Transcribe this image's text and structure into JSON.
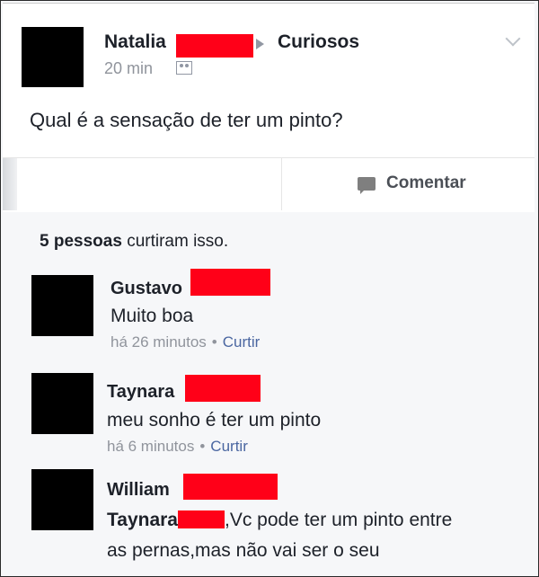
{
  "post": {
    "author": "Natalia",
    "group": "Curiosos",
    "time": "20 min",
    "text": "Qual é a sensação de ter um pinto?"
  },
  "actions": {
    "comment_label": "Comentar"
  },
  "likes": {
    "count": "5 pessoas",
    "suffix": "curtiram isso."
  },
  "comments": [
    {
      "author": "Gustavo",
      "text": "Muito boa",
      "time": "há 26 minutos",
      "like": "Curtir"
    },
    {
      "author": "Taynara",
      "text": "meu sonho é ter um pinto",
      "time": "há 6 minutos",
      "like": "Curtir"
    },
    {
      "author": "William",
      "mention": "Taynara",
      "text": ",Vc pode ter um pinto entre",
      "text2": "as pernas,mas não vai ser o seu"
    }
  ],
  "colors": {
    "redaction": "#ff0018",
    "link": "#4b67a1",
    "meta": "#90949c"
  }
}
